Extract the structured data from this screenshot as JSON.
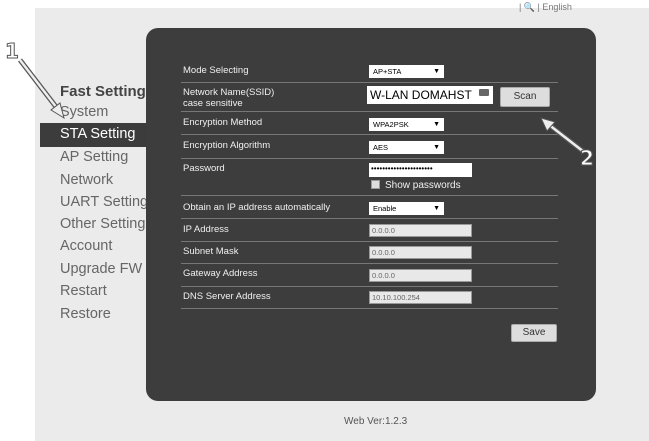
{
  "header": {
    "language": "| 🔍 | English"
  },
  "sidebar": {
    "title": "Fast Setting",
    "active_label": "STA Setting",
    "items": [
      "System",
      "AP Setting",
      "Network",
      "UART Setting",
      "Other Setting",
      "Account",
      "Upgrade FW",
      "Restart",
      "Restore"
    ]
  },
  "form": {
    "mode_label": "Mode Selecting",
    "mode_value": "AP+STA",
    "ssid_label_1": "Network Name(SSID)",
    "ssid_label_2": "case sensitive",
    "ssid_value": "W-LAN DOMAHST",
    "scan_label": "Scan",
    "enc_method_label": "Encryption Method",
    "enc_method_value": "WPA2PSK",
    "enc_algo_label": "Encryption Algorithm",
    "enc_algo_value": "AES",
    "password_label": "Password",
    "password_value": "••••••••••••••••••••••",
    "show_passwords_label": "Show passwords",
    "dhcp_label": "Obtain an IP address automatically",
    "dhcp_value": "Enable",
    "ip_label": "IP Address",
    "ip_value": "0.0.0.0",
    "mask_label": "Subnet Mask",
    "mask_value": "0.0.0.0",
    "gateway_label": "Gateway Address",
    "gateway_value": "0.0.0.0",
    "dns_label": "DNS Server Address",
    "dns_value": "10.10.100.254",
    "save_label": "Save"
  },
  "footer": {
    "version": "Web Ver:1.2.3"
  },
  "callouts": {
    "one": "1",
    "two": "2"
  }
}
